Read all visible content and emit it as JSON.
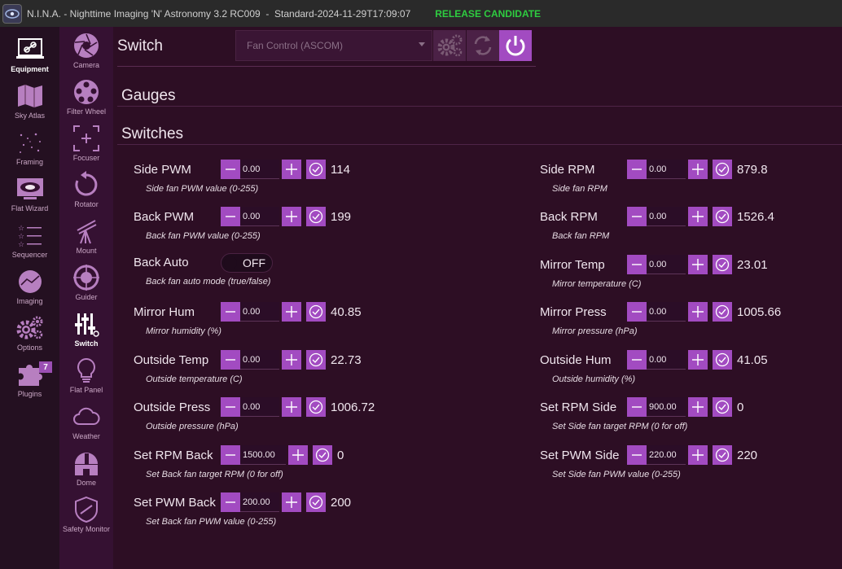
{
  "window": {
    "title": "N.I.N.A. - Nighttime Imaging 'N' Astronomy 3.2 RC009  -  Standard-2024-11-29T17:09:07",
    "badge": "RELEASE CANDIDATE"
  },
  "nav_primary": [
    {
      "label": "Equipment",
      "icon": "equipment-icon",
      "active": true
    },
    {
      "label": "Sky Atlas",
      "icon": "map-icon"
    },
    {
      "label": "Framing",
      "icon": "framing-icon"
    },
    {
      "label": "Flat Wizard",
      "icon": "flat-wizard-icon"
    },
    {
      "label": "Sequencer",
      "icon": "sequencer-icon"
    },
    {
      "label": "Imaging",
      "icon": "imaging-icon"
    },
    {
      "label": "Options",
      "icon": "gear-icon"
    },
    {
      "label": "Plugins",
      "icon": "puzzle-icon",
      "badge": "7"
    }
  ],
  "nav_equipment": [
    {
      "label": "Camera",
      "icon": "camera-icon"
    },
    {
      "label": "Filter Wheel",
      "icon": "filter-wheel-icon"
    },
    {
      "label": "Focuser",
      "icon": "focuser-icon"
    },
    {
      "label": "Rotator",
      "icon": "rotator-icon"
    },
    {
      "label": "Mount",
      "icon": "telescope-icon"
    },
    {
      "label": "Guider",
      "icon": "guider-icon"
    },
    {
      "label": "Switch",
      "icon": "switch-icon",
      "active": true
    },
    {
      "label": "Flat Panel",
      "icon": "lightbulb-icon"
    },
    {
      "label": "Weather",
      "icon": "cloud-icon"
    },
    {
      "label": "Dome",
      "icon": "dome-icon"
    },
    {
      "label": "Safety Monitor",
      "icon": "shield-icon"
    }
  ],
  "main": {
    "title": "Switch",
    "device_select": "Fan Control (ASCOM)",
    "sections": {
      "gauges": "Gauges",
      "switches": "Switches"
    }
  },
  "switches_left": [
    {
      "name": "Side PWM",
      "desc": "Side fan PWM value (0-255)",
      "input": "0.00",
      "value": "114",
      "type": "number"
    },
    {
      "name": "Back PWM",
      "desc": "Back fan PWM value (0-255)",
      "input": "0.00",
      "value": "199",
      "type": "number"
    },
    {
      "name": "Back Auto",
      "desc": "Back fan auto mode (true/false)",
      "toggle": "OFF",
      "type": "toggle"
    },
    {
      "name": "Mirror Hum",
      "desc": "Mirror humidity (%)",
      "input": "0.00",
      "value": "40.85",
      "type": "number"
    },
    {
      "name": "Outside Temp",
      "desc": "Outside temperature (C)",
      "input": "0.00",
      "value": "22.73",
      "type": "number"
    },
    {
      "name": "Outside Press",
      "desc": "Outside pressure (hPa)",
      "input": "0.00",
      "value": "1006.72",
      "type": "number"
    },
    {
      "name": "Set RPM Back",
      "desc": "Set Back fan target RPM (0 for off)",
      "input": "1500.00",
      "value": "0",
      "type": "number"
    },
    {
      "name": "Set PWM Back",
      "desc": "Set Back fan PWM value (0-255)",
      "input": "200.00",
      "value": "200",
      "type": "number"
    }
  ],
  "switches_right": [
    {
      "name": "Side RPM",
      "desc": "Side fan RPM",
      "input": "0.00",
      "value": "879.8",
      "type": "number"
    },
    {
      "name": "Back RPM",
      "desc": "Back fan RPM",
      "input": "0.00",
      "value": "1526.4",
      "type": "number"
    },
    {
      "name": "Mirror Temp",
      "desc": "Mirror temperature (C)",
      "input": "0.00",
      "value": "23.01",
      "type": "number"
    },
    {
      "name": "Mirror Press",
      "desc": "Mirror pressure (hPa)",
      "input": "0.00",
      "value": "1005.66",
      "type": "number"
    },
    {
      "name": "Outside Hum",
      "desc": "Outside humidity (%)",
      "input": "0.00",
      "value": "41.05",
      "type": "number"
    },
    {
      "name": "Set RPM Side",
      "desc": "Set Side fan target RPM (0 for off)",
      "input": "900.00",
      "value": "0",
      "type": "number"
    },
    {
      "name": "Set PWM Side",
      "desc": "Set Side fan PWM value (0-255)",
      "input": "220.00",
      "value": "220",
      "type": "number"
    }
  ],
  "colors": {
    "accent": "#a24bc1",
    "background": "#2d0e24",
    "release": "#2ecc40"
  }
}
